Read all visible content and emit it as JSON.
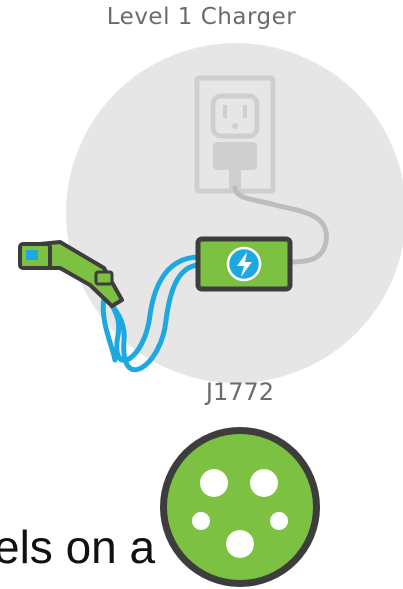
{
  "header": {
    "title": "Level 1 Charger"
  },
  "connector": {
    "label": "J1772"
  },
  "caption": {
    "text": "els on a"
  },
  "icons": {
    "outlet": "wall-outlet-icon",
    "plug": "charger-plug-icon",
    "charger_box": "charging-box-icon",
    "lightning": "lightning-bolt-icon",
    "handle": "ev-charging-handle-icon",
    "cable": "charging-cable-icon",
    "j1772_port": "j1772-connector-icon"
  },
  "colors": {
    "circle_bg": "#e6e6e6",
    "outlet": "#cfcfcf",
    "green": "#7cc142",
    "dark_outline": "#3d3d3d",
    "blue": "#1ea8e0",
    "text_gray": "#6b6b6b"
  }
}
